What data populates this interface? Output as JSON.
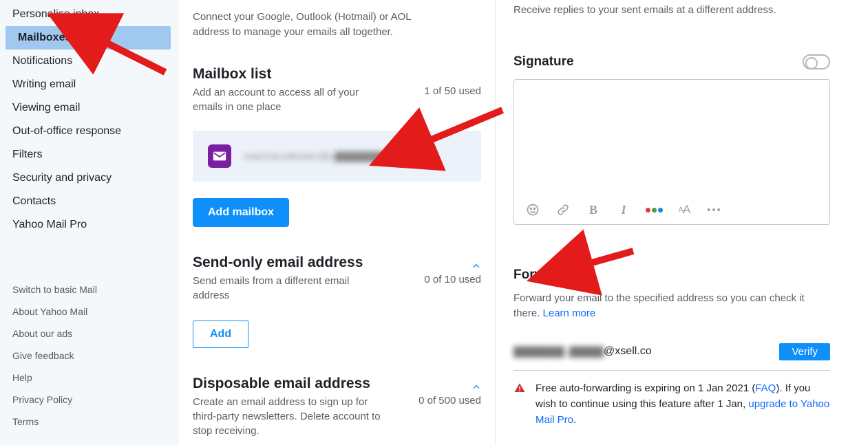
{
  "sidebar": {
    "items": [
      "Personalise inbox",
      "Mailboxes",
      "Notifications",
      "Writing email",
      "Viewing email",
      "Out-of-office response",
      "Filters",
      "Security and privacy",
      "Contacts",
      "Yahoo Mail Pro"
    ],
    "selected_index": 1,
    "links": [
      "Switch to basic Mail",
      "About Yahoo Mail",
      "About our ads",
      "Give feedback",
      "Help",
      "Privacy Policy",
      "Terms"
    ]
  },
  "center": {
    "connect_desc": "Connect your Google, Outlook (Hotmail) or AOL address to manage your emails all together.",
    "mailbox_list": {
      "title": "Mailbox list",
      "sub": "Add an account to access all of your emails in one place",
      "used": "1 of 50 used",
      "email_masked": "marinacollester@y▇▇▇▇▇▇",
      "add_btn": "Add mailbox"
    },
    "send_only": {
      "title": "Send-only email address",
      "sub": "Send emails from a different email address",
      "used": "0 of 10 used",
      "add_btn": "Add"
    },
    "disposable": {
      "title": "Disposable email address",
      "sub": "Create an email address to sign up for third-party newsletters. Delete account to stop receiving.",
      "used": "0 of 500 used"
    }
  },
  "right": {
    "reply_desc": "Receive replies to your sent emails at a different address.",
    "signature": {
      "title": "Signature",
      "toggle_on": false
    },
    "forwarding": {
      "title": "Forwarding",
      "desc_pre": "Forward your email to the specified address so you can check it there. ",
      "learn_more": "Learn more",
      "email_masked_prefix": "▇▇▇▇▇▇ j▇▇▇▇",
      "email_suffix": "@xsell.co",
      "verify_btn": "Verify",
      "warn_pre": "Free auto-forwarding is expiring on 1 Jan 2021 (",
      "faq": "FAQ",
      "warn_mid": "). If you wish to continue using this feature after 1 Jan, ",
      "upgrade": "upgrade to Yahoo Mail Pro",
      "warn_post": "."
    }
  }
}
